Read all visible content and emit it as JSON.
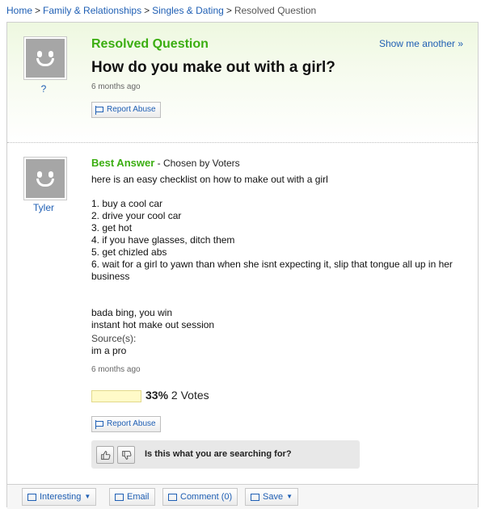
{
  "breadcrumb": {
    "items": [
      "Home",
      "Family & Relationships",
      "Singles & Dating"
    ],
    "separator": ">",
    "current": "Resolved Question"
  },
  "question": {
    "status": "Resolved Question",
    "show_another": "Show me another »",
    "title": "How do you make out with a girl?",
    "asker": "?",
    "time": "6 months ago",
    "report": "Report Abuse"
  },
  "answer": {
    "label": "Best Answer",
    "chosen_by": " - Chosen by Voters",
    "user": "Tyler",
    "intro": "here is an easy checklist on how to make out with a girl",
    "list": [
      "1. buy a cool car",
      "2. drive your cool car",
      "3. get hot",
      "4. if you have glasses, ditch them",
      "5. get chizled abs",
      "6. wait for a girl to yawn than when she isnt expecting it, slip that tongue all up in her business"
    ],
    "outro": [
      "bada bing, you win",
      "instant hot make out session"
    ],
    "sources_label": "Source(s):",
    "sources_value": "im a pro",
    "time": "6 months ago",
    "vote_percent": "33%",
    "vote_percent_value": 33,
    "vote_count": "2 Votes",
    "report": "Report Abuse"
  },
  "feedback": {
    "question": "Is this what you are searching for?",
    "thumbs_up_icon": "thumbs-up-icon",
    "thumbs_down_icon": "thumbs-down-icon"
  },
  "actions": {
    "interesting": "Interesting",
    "email": "Email",
    "comment": "Comment (0)",
    "save": "Save"
  },
  "colors": {
    "accent_green": "#3bae11",
    "link_blue": "#1f5fb4",
    "vote_bar": "#fffac8"
  }
}
